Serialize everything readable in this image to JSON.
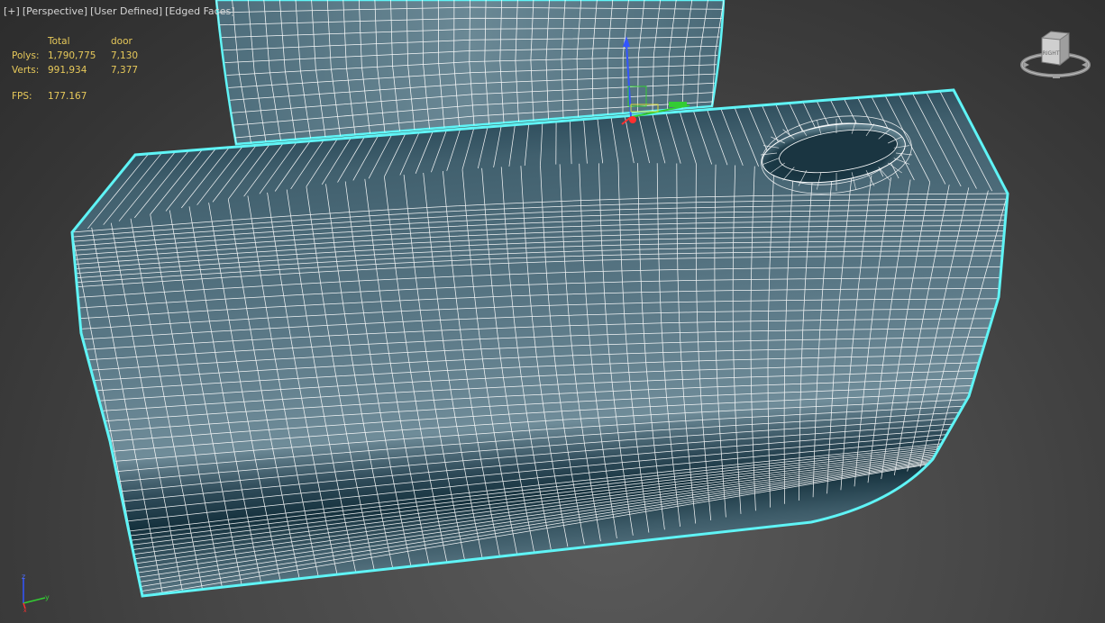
{
  "viewport_labels": {
    "menu": "[+]",
    "view": "[Perspective]",
    "shading": "[User Defined]",
    "edges": "[Edged Faces]"
  },
  "stats": {
    "header": {
      "total": "Total",
      "object": "door"
    },
    "polys": {
      "label": "Polys:",
      "total": "1,790,775",
      "object": "7,130"
    },
    "verts": {
      "label": "Verts:",
      "total": "991,934",
      "object": "7,377"
    },
    "fps": {
      "label": "FPS:",
      "value": "177.167"
    }
  },
  "viewcube": {
    "face_label": "RIGHT"
  },
  "axis_tripod": {
    "z": "z",
    "y": "y",
    "x": "x"
  },
  "colors": {
    "stats_text": "#e7c95a",
    "selection_outline": "#5ff4f6",
    "wire": "#ffffff",
    "gizmo_x": "#ff3030",
    "gizmo_y": "#33cc33",
    "gizmo_z": "#3355ff"
  },
  "icons": [
    "viewcube-icon",
    "transform-gizmo-icon",
    "axis-tripod-icon"
  ]
}
